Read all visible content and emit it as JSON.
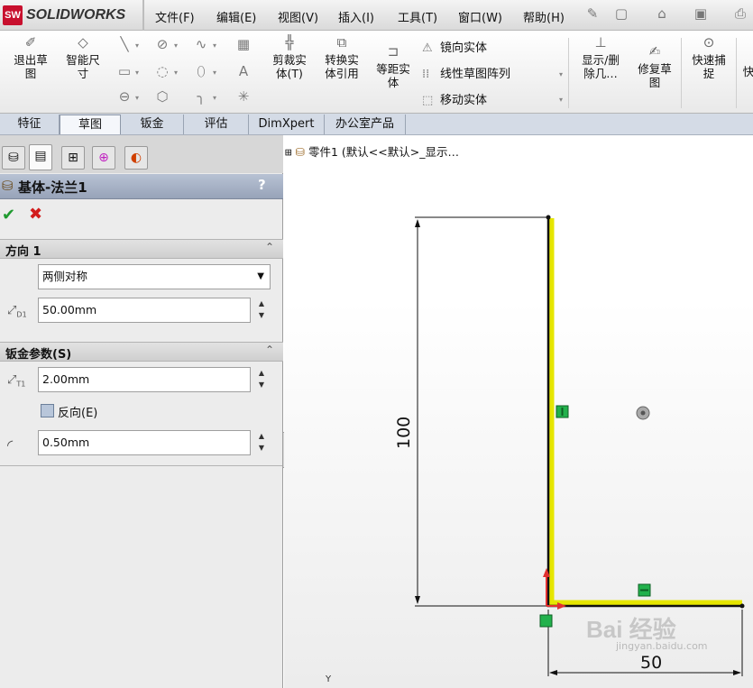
{
  "app": {
    "brand": "SOLIDWORKS",
    "logo_mark": "SW"
  },
  "menu": [
    "文件(F)",
    "编辑(E)",
    "视图(V)",
    "插入(I)",
    "工具(T)",
    "窗口(W)",
    "帮助(H)"
  ],
  "quick_access": [
    "pin-icon",
    "new-icon",
    "open-icon",
    "save-icon",
    "print-icon"
  ],
  "ribbon": {
    "exit_sketch": "退出草\n图",
    "smart_dim": "智能尺\n寸",
    "trim": "剪裁实\n体(T)",
    "convert": "转换实\n体引用",
    "offset": "等距实\n体",
    "mirror": "镜向实体",
    "linear_pattern": "线性草图阵列",
    "move": "移动实体",
    "show_delete": "显示/删\n除几…",
    "repair": "修复草\n图",
    "quick_snap": "快速捕\n捉",
    "fast": "快"
  },
  "tabs": [
    "特征",
    "草图",
    "钣金",
    "评估",
    "DimXpert",
    "办公室产品"
  ],
  "active_tab": "草图",
  "panel": {
    "title": "基体-法兰1",
    "help": "?",
    "ok": "✔",
    "cancel": "✖",
    "direction_group": "方向 1",
    "end_condition": "两侧对称",
    "depth": "50.00mm",
    "depth_label": "D1",
    "sheet_group": "钣金参数(S)",
    "thickness": "2.00mm",
    "thickness_label": "T1",
    "reverse": "反向(E)",
    "radius": "0.50mm"
  },
  "tree_label": "零件1 (默认<<默认>_显示…",
  "dims": {
    "horizontal": "50",
    "vertical": "100"
  },
  "axis_label": "Y",
  "watermark": {
    "main": "Bai 经验",
    "sub": "jingyan.baidu.com"
  },
  "colors": {
    "accent_yellow": "#e6e600",
    "sketch_line": "#111111",
    "relation_green": "#22b14c",
    "origin_red": "#e03030"
  }
}
